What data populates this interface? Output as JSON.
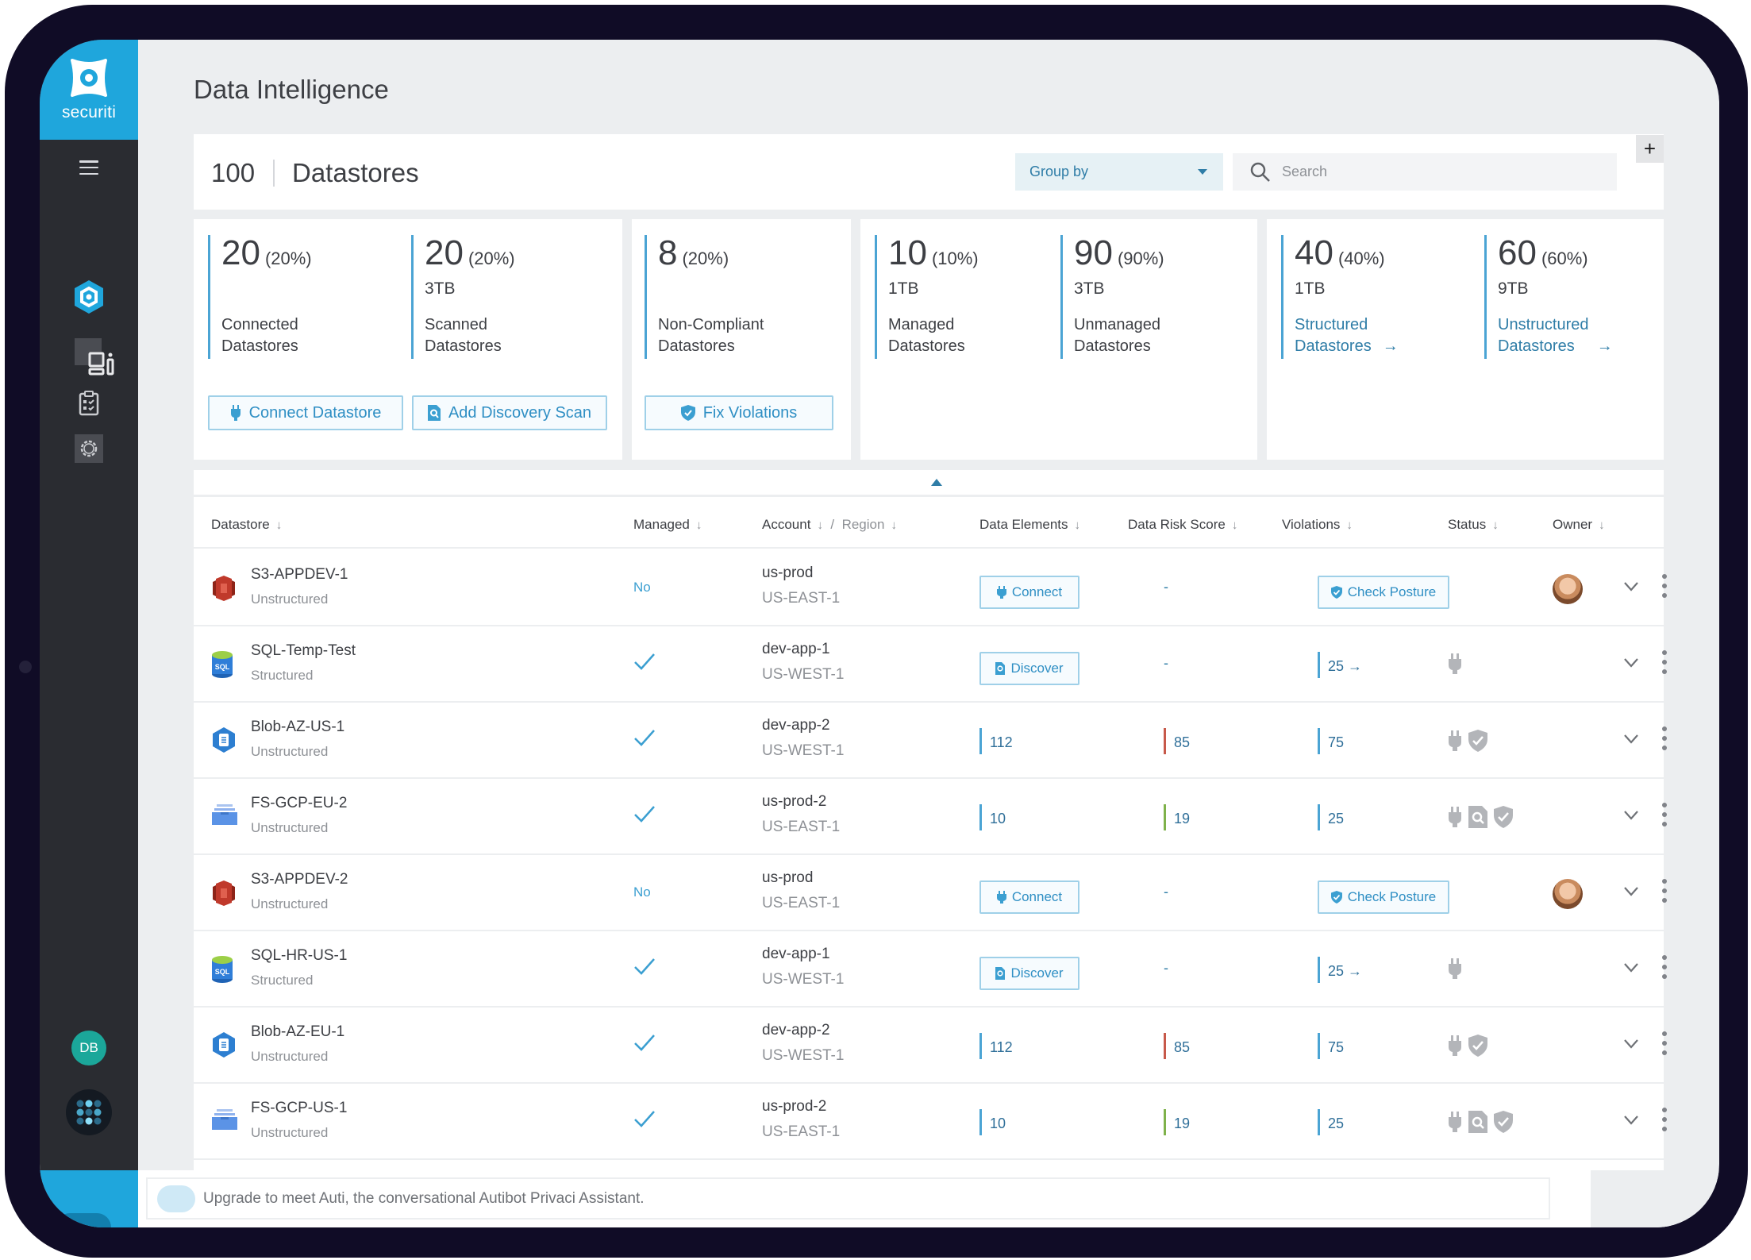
{
  "app": {
    "brand": "securiti",
    "page_title": "Data Intelligence",
    "user_initials": "DB"
  },
  "colors": {
    "brand_blue": "#1fa6dc",
    "sidebar": "#2a2c31",
    "link": "#2f7da7",
    "accent_bar": "#4ba4d4",
    "risk_high": "#c7594a",
    "risk_low": "#7fb24b"
  },
  "sidebar": {
    "items": [
      {
        "icon": "hexagon-logo-icon",
        "label": "Data Intelligence"
      },
      {
        "icon": "dashboard-icon",
        "label": "Dashboard"
      },
      {
        "icon": "clipboard-checklist-icon",
        "label": "Assessments"
      },
      {
        "icon": "gear-icon",
        "label": "Settings"
      }
    ],
    "apps_icon": "apps-grid-icon"
  },
  "header": {
    "count": "100",
    "label": "Datastores",
    "group_by": "Group by",
    "search_placeholder": "Search",
    "add_label": "+"
  },
  "stats": {
    "connected": {
      "num": "20",
      "pct": "(20%)",
      "size": "",
      "label1": "Connected",
      "label2": "Datastores"
    },
    "scanned": {
      "num": "20",
      "pct": "(20%)",
      "size": "3TB",
      "label1": "Scanned",
      "label2": "Datastores"
    },
    "noncompliant": {
      "num": "8",
      "pct": "(20%)",
      "size": "",
      "label1": "Non-Compliant",
      "label2": "Datastores"
    },
    "managed": {
      "num": "10",
      "pct": "(10%)",
      "size": "1TB",
      "label1": "Managed",
      "label2": "Datastores"
    },
    "unmanaged": {
      "num": "90",
      "pct": "(90%)",
      "size": "3TB",
      "label1": "Unmanaged",
      "label2": "Datastores"
    },
    "structured": {
      "num": "40",
      "pct": "(40%)",
      "size": "1TB",
      "label1": "Structured",
      "label2": "Datastores"
    },
    "unstructured": {
      "num": "60",
      "pct": "(60%)",
      "size": "9TB",
      "label1": "Unstructured",
      "label2": "Datastores"
    },
    "buttons": {
      "connect": "Connect Datastore",
      "scan": "Add Discovery Scan",
      "fix": "Fix Violations"
    }
  },
  "table": {
    "columns": {
      "datastore": "Datastore",
      "managed": "Managed",
      "account": "Account",
      "region": "Region",
      "data_elements": "Data Elements",
      "risk": "Data Risk Score",
      "violations": "Violations",
      "status": "Status",
      "owner": "Owner"
    },
    "rows": [
      {
        "name": "S3-APPDEV-1",
        "type": "Unstructured",
        "icon": "aws-s3-icon",
        "managed": "No",
        "account": "us-prod",
        "region": "US-EAST-1",
        "data_elements_action": "Connect",
        "risk": "-",
        "violations_action": "Check Posture",
        "status": [],
        "owner": "avatar"
      },
      {
        "name": "SQL-Temp-Test",
        "type": "Structured",
        "icon": "azure-sql-icon",
        "managed": "yes",
        "account": "dev-app-1",
        "region": "US-WEST-1",
        "data_elements_action": "Discover",
        "risk": "-",
        "violations": "25 →",
        "status": [
          "plug"
        ],
        "owner": ""
      },
      {
        "name": "Blob-AZ-US-1",
        "type": "Unstructured",
        "icon": "azure-blob-icon",
        "managed": "yes",
        "account": "dev-app-2",
        "region": "US-WEST-1",
        "data_elements": "112",
        "risk": "85",
        "risk_level": "high",
        "violations": "75",
        "status": [
          "plug",
          "shield"
        ],
        "owner": ""
      },
      {
        "name": "FS-GCP-EU-2",
        "type": "Unstructured",
        "icon": "gcp-filestore-icon",
        "managed": "yes",
        "account": "us-prod-2",
        "region": "US-EAST-1",
        "data_elements": "10",
        "risk": "19",
        "risk_level": "low",
        "violations": "25",
        "status": [
          "plug",
          "scan",
          "shield"
        ],
        "owner": ""
      },
      {
        "name": "S3-APPDEV-2",
        "type": "Unstructured",
        "icon": "aws-s3-icon",
        "managed": "No",
        "account": "us-prod",
        "region": "US-EAST-1",
        "data_elements_action": "Connect",
        "risk": "-",
        "violations_action": "Check Posture",
        "status": [],
        "owner": "avatar"
      },
      {
        "name": "SQL-HR-US-1",
        "type": "Structured",
        "icon": "azure-sql-icon",
        "managed": "yes",
        "account": "dev-app-1",
        "region": "US-WEST-1",
        "data_elements_action": "Discover",
        "risk": "-",
        "violations": "25 →",
        "status": [
          "plug"
        ],
        "owner": ""
      },
      {
        "name": "Blob-AZ-EU-1",
        "type": "Unstructured",
        "icon": "azure-blob-icon",
        "managed": "yes",
        "account": "dev-app-2",
        "region": "US-WEST-1",
        "data_elements": "112",
        "risk": "85",
        "risk_level": "high",
        "violations": "75",
        "status": [
          "plug",
          "shield"
        ],
        "owner": ""
      },
      {
        "name": "FS-GCP-US-1",
        "type": "Unstructured",
        "icon": "gcp-filestore-icon",
        "managed": "yes",
        "account": "us-prod-2",
        "region": "US-EAST-1",
        "data_elements": "10",
        "risk": "19",
        "risk_level": "low",
        "violations": "25",
        "status": [
          "plug",
          "scan",
          "shield"
        ],
        "owner": ""
      }
    ]
  },
  "assistant": {
    "placeholder": "Upgrade to meet Auti, the conversational Autibot Privaci Assistant."
  }
}
